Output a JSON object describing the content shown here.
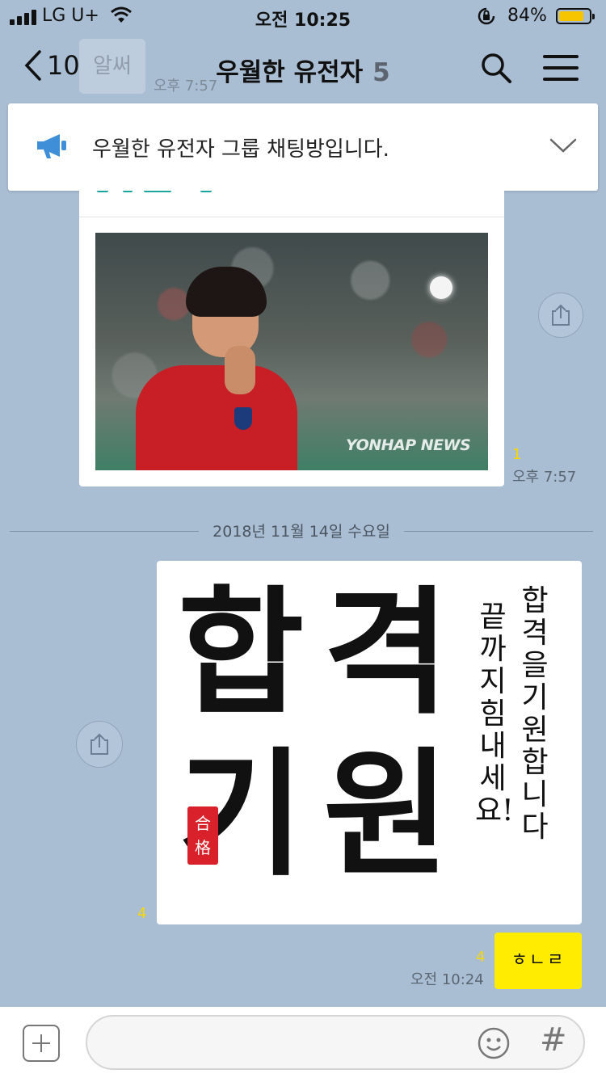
{
  "status_bar": {
    "carrier": "LG U+",
    "time": "오전 10:25",
    "battery_percent": "84%",
    "battery_level": 0.84,
    "battery_color": "#f6c500"
  },
  "nav": {
    "back_count": "10",
    "title": "우월한 유전자",
    "member_count": "5",
    "search_icon": "search-icon",
    "menu_icon": "menu-icon"
  },
  "background_message": {
    "text": "알써",
    "time": "오후 7:57"
  },
  "notice": {
    "text": "우월한 유전자 그룹 채팅방입니다.",
    "icon": "megaphone-icon"
  },
  "link_card": {
    "watermark": "YONHAP NEWS",
    "read_count": "1",
    "time": "오후 7:57",
    "accent": "#1aa69b"
  },
  "date_divider": "2018년 11월 14일 수요일",
  "sticker": {
    "big_chars": [
      "합",
      "격",
      "기",
      "원"
    ],
    "seal_text": "合格",
    "line1": "합격을 기원합니다",
    "line2": "끝까지 힘내세요!",
    "read_count": "4"
  },
  "my_message": {
    "text": "ㅎㄴㄹ",
    "read_count": "4",
    "time": "오전 10:24",
    "bubble_color": "#ffec00"
  },
  "input_bar": {
    "plus_icon": "plus-icon",
    "emoji_icon": "emoji-icon",
    "hash_label": "#"
  }
}
